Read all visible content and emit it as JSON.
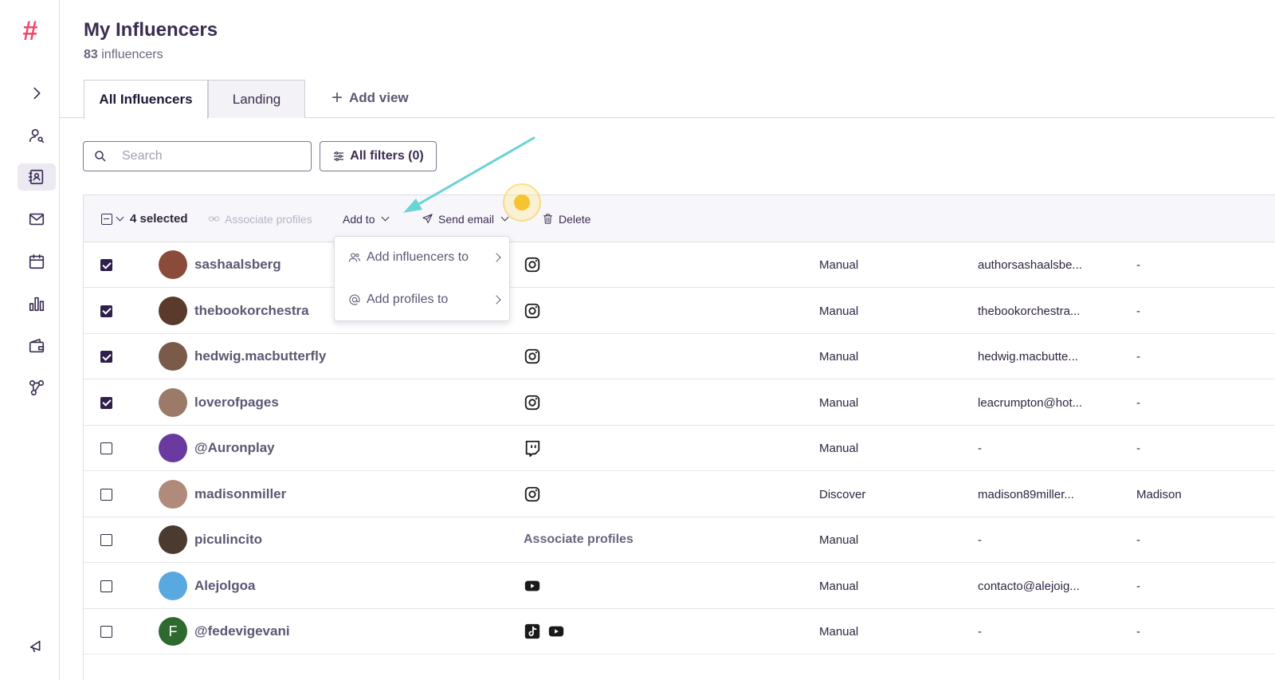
{
  "sidebar": {
    "logo": "#",
    "icons": [
      "chevron-right-icon",
      "user-search-icon",
      "contacts-icon",
      "mail-icon",
      "calendar-icon",
      "bar-chart-icon",
      "wallet-icon",
      "network-icon",
      "megaphone-icon"
    ]
  },
  "header": {
    "title": "My Influencers",
    "count": "83",
    "count_label": "influencers"
  },
  "tabs": [
    {
      "label": "All Influencers",
      "active": true
    },
    {
      "label": "Landing",
      "active": false
    }
  ],
  "add_view_label": "Add view",
  "search": {
    "placeholder": "Search",
    "value": ""
  },
  "filters_label": "All filters (0)",
  "toolbar": {
    "selected_label": "4 selected",
    "associate_label": "Associate profiles",
    "add_to_label": "Add to",
    "send_email_label": "Send email",
    "delete_label": "Delete"
  },
  "dropdown": {
    "items": [
      {
        "label": "Add influencers to",
        "icon": "users-icon"
      },
      {
        "label": "Add profiles to",
        "icon": "at-icon"
      }
    ]
  },
  "rows": [
    {
      "handle": "sashaalsberg",
      "checked": true,
      "platforms": [
        "instagram"
      ],
      "source": "Manual",
      "email": "authorsashaalsbe...",
      "name": "-"
    },
    {
      "handle": "thebookorchestra",
      "checked": true,
      "platforms": [
        "instagram"
      ],
      "source": "Manual",
      "email": "thebookorchestra...",
      "name": "-"
    },
    {
      "handle": "hedwig.macbutterfly",
      "checked": true,
      "platforms": [
        "instagram"
      ],
      "source": "Manual",
      "email": "hedwig.macbutte...",
      "name": "-"
    },
    {
      "handle": "loverofpages",
      "checked": true,
      "platforms": [
        "instagram"
      ],
      "source": "Manual",
      "email": "leacrumpton@hot...",
      "name": "-"
    },
    {
      "handle": "@Auronplay",
      "checked": false,
      "platforms": [
        "twitch"
      ],
      "source": "Manual",
      "email": "-",
      "name": "-"
    },
    {
      "handle": "madisonmiller",
      "checked": false,
      "platforms": [
        "instagram"
      ],
      "source": "Discover",
      "email": "madison89miller...",
      "name": "Madison"
    },
    {
      "handle": "piculincito",
      "checked": false,
      "platforms": [],
      "platform_text": "Associate profiles",
      "source": "Manual",
      "email": "-",
      "name": "-"
    },
    {
      "handle": "Alejolgoa",
      "checked": false,
      "platforms": [
        "youtube"
      ],
      "source": "Manual",
      "email": "contacto@alejoig...",
      "name": "-"
    },
    {
      "handle": "@fedevigevani",
      "checked": false,
      "avatar_letter": "F",
      "platforms": [
        "tiktok",
        "youtube"
      ],
      "source": "Manual",
      "email": "-",
      "name": "-"
    }
  ],
  "colors": {
    "accent": "#2f1f4a",
    "logo": "#f04a6b",
    "annotation_arrow": "#6ad3d6",
    "click_marker": "#f6c431"
  }
}
